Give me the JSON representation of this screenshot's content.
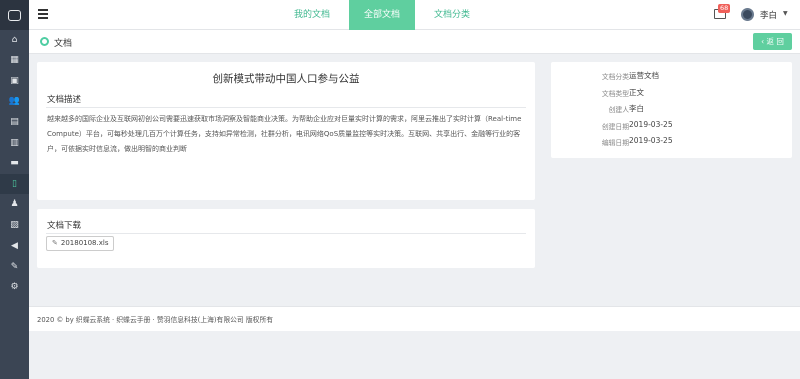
{
  "sidebar": {
    "logo": "app-logo",
    "items": [
      {
        "icon": "home-icon",
        "glyph": "⌂"
      },
      {
        "icon": "grid-icon",
        "glyph": "▦"
      },
      {
        "icon": "briefcase-icon",
        "glyph": "▣"
      },
      {
        "icon": "users-icon",
        "glyph": "👥"
      },
      {
        "icon": "calendar-icon",
        "glyph": "▤"
      },
      {
        "icon": "book-icon",
        "glyph": "▥"
      },
      {
        "icon": "server-icon",
        "glyph": "▬"
      },
      {
        "icon": "document-icon",
        "glyph": "▯"
      },
      {
        "icon": "person-icon",
        "glyph": "♟"
      },
      {
        "icon": "image-icon",
        "glyph": "▨"
      },
      {
        "icon": "bullhorn-icon",
        "glyph": "◀"
      },
      {
        "icon": "hammer-icon",
        "glyph": "✎"
      },
      {
        "icon": "gear-icon",
        "glyph": "⚙"
      }
    ],
    "active_index": 7
  },
  "topbar": {
    "tabs": [
      {
        "label": "我的文档",
        "active": false
      },
      {
        "label": "全部文档",
        "active": true
      },
      {
        "label": "文档分类",
        "active": false
      }
    ],
    "mail_badge": "68",
    "user_name": "李白"
  },
  "subheader": {
    "title": "文档",
    "back_label": "‹ 返 回"
  },
  "doc": {
    "title": "创新模式带动中国人口参与公益",
    "desc_heading": "文档描述",
    "description": "越来越多的国际企业及互联网初创公司需要迅速获取市场洞察及智能商业决策。为帮助企业应对巨量实时计算的需求，阿里云推出了实时计算（Real-time Compute）平台，可每秒处理几百万个计算任务，支持如异常检测，社群分析，电讯网络QoS质量监控等实时决策。互联网、共享出行、金融等行业的客户，可依据实时信息流，做出明智的商业判断",
    "download_heading": "文档下载",
    "file_name": "20180108.xls"
  },
  "meta": [
    {
      "label": "文档分类",
      "value": "运营文档"
    },
    {
      "label": "文档类型",
      "value": "正文"
    },
    {
      "label": "创建人",
      "value": "李白"
    },
    {
      "label": "创建日期",
      "value": "2019-03-25"
    },
    {
      "label": "编辑日期",
      "value": "2019-03-25"
    }
  ],
  "footer": {
    "text": "2020 © by 织蝶云系统 · 织蝶云手册 · 赞羽信息科技(上海)有限公司 版权所有"
  },
  "colors": {
    "accent": "#5fcf9f",
    "sidebar": "#3b4554",
    "badge": "#f0605a"
  }
}
